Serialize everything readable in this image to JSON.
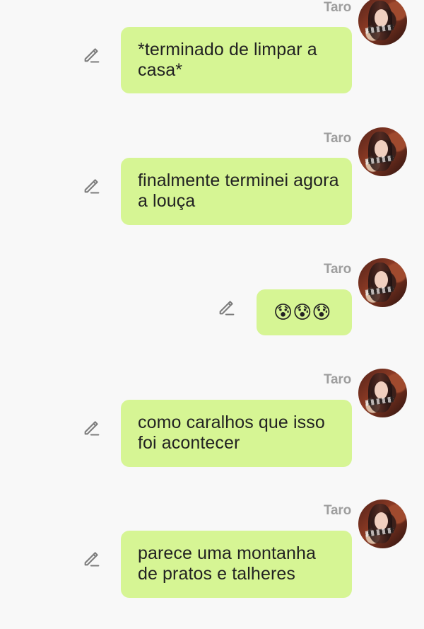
{
  "messages": [
    {
      "sender": "Taro",
      "text": "*terminado de limpar a casa*"
    },
    {
      "sender": "Taro",
      "text": "finalmente terminei agora a louça"
    },
    {
      "sender": "Taro",
      "emoji": "😰😰😰"
    },
    {
      "sender": "Taro",
      "text": "como caralhos que isso foi acontecer"
    },
    {
      "sender": "Taro",
      "text": "parece uma montanha de pratos e talheres"
    }
  ],
  "colors": {
    "background": "#f8f8f8",
    "bubble": "#d6f594",
    "sender": "#9e9e9e",
    "text": "#222222"
  }
}
